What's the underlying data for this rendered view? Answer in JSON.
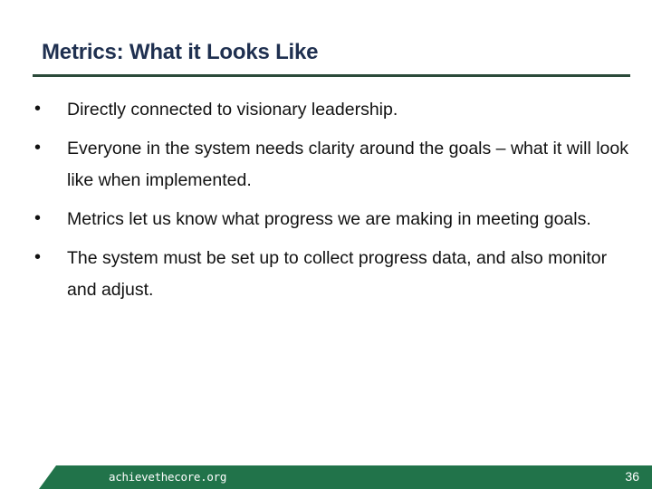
{
  "slide": {
    "title": "Metrics: What it Looks Like",
    "bullets": [
      "Directly connected to visionary leadership.",
      "Everyone in the system needs clarity around the goals – what it will look like when implemented.",
      "Metrics let us know what progress we are making in meeting goals.",
      "The system must be set up to collect progress data, and also monitor and adjust."
    ],
    "bullet_glyph": "•"
  },
  "footer": {
    "site": "achievethecore.org",
    "page_number": "36"
  },
  "colors": {
    "title": "#1F3050",
    "title_rule": "#2B4A3A",
    "footer_band": "#21734A",
    "body_text": "#111111"
  }
}
